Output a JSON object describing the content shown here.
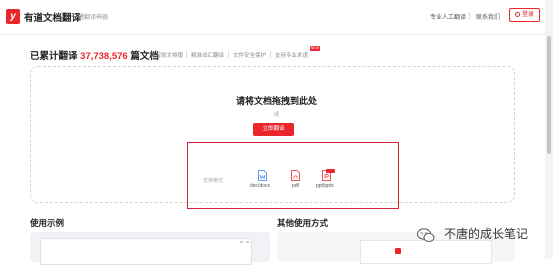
{
  "header": {
    "logo_glyph": "y",
    "app_title": "有道文档翻译",
    "slogan": "一键翻译神器",
    "links": [
      "专业人工翻译",
      "联系我们"
    ],
    "login_label": "登录"
  },
  "stats": {
    "prefix": "已累计翻译",
    "count": "37,738,576",
    "suffix": "篇文档",
    "features": [
      "保留原文排版",
      "精准词汇翻译",
      "文件安全保护",
      "支持专业术语"
    ],
    "new_badge": "NEW"
  },
  "upload": {
    "title": "请将文档拖拽到此处",
    "or_text": "或",
    "button_label": "立即翻译",
    "support_label": "支持格式",
    "formats": [
      {
        "label": "doc/docx",
        "icon": "word-file-icon",
        "color": "#3b7de9"
      },
      {
        "label": "pdf",
        "icon": "pdf-file-icon",
        "color": "#e8262b"
      },
      {
        "label": "ppt/pptx",
        "icon": "ppt-file-icon",
        "color": "#e8262b"
      }
    ]
  },
  "sections": {
    "examples": "使用示例",
    "other_ways": "其他使用方式"
  },
  "watermark": {
    "text": "不唐的成长笔记"
  },
  "colors": {
    "accent": "#e8262b",
    "annotation_box": "#d0262f"
  }
}
